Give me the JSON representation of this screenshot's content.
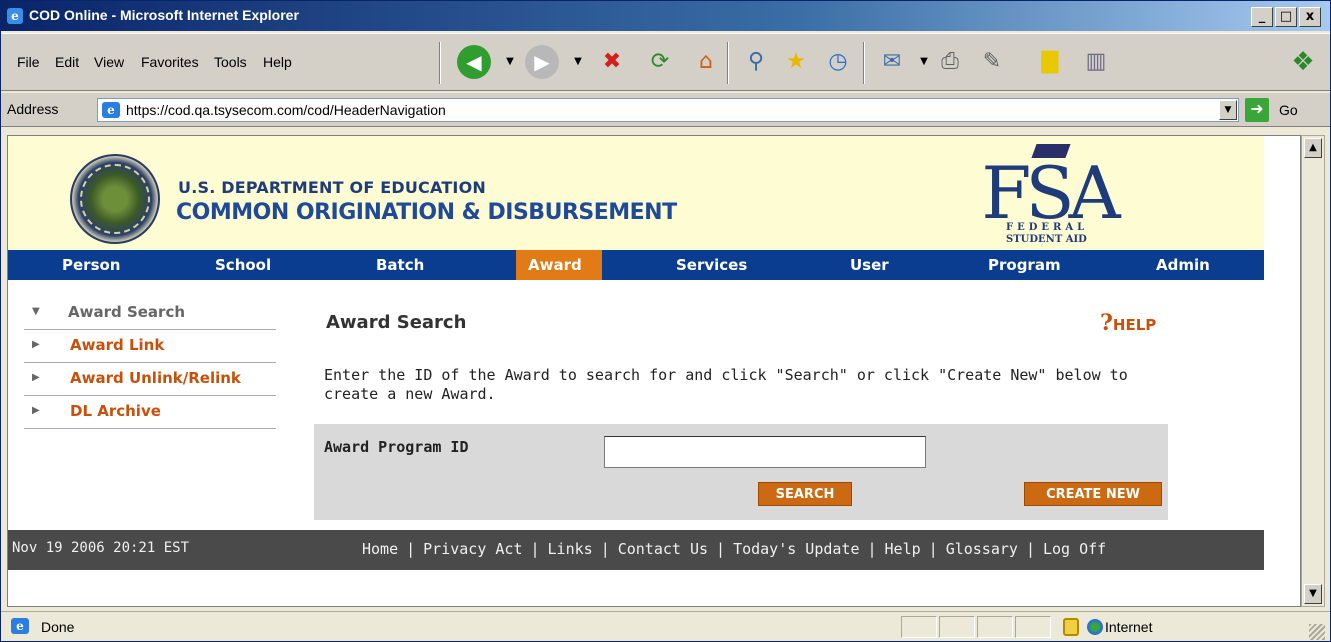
{
  "window": {
    "title": "COD Online - Microsoft Internet Explorer",
    "minimize": "_",
    "maximize": "□",
    "close": "x"
  },
  "menu": {
    "items": [
      "File",
      "Edit",
      "View",
      "Favorites",
      "Tools",
      "Help"
    ]
  },
  "toolbar": {
    "icons": [
      "back-icon",
      "forward-icon",
      "stop-icon",
      "refresh-icon",
      "home-icon",
      "search-icon",
      "favorites-icon",
      "history-icon",
      "mail-icon",
      "print-icon",
      "edit-icon",
      "discuss-icon",
      "research-icon"
    ]
  },
  "address": {
    "label": "Address",
    "url": "https://cod.qa.tsysecom.com/cod/HeaderNavigation",
    "go_label": "Go"
  },
  "banner": {
    "dept": "U.S. DEPARTMENT OF EDUCATION",
    "system": "COMMON ORIGINATION & DISBURSEMENT",
    "fsa_big": "FSA",
    "fsa_federal": "FEDERAL",
    "fsa_student_aid": "STUDENT AID"
  },
  "nav": {
    "items": [
      "Person",
      "School",
      "Batch",
      "Award",
      "Services",
      "User",
      "Program",
      "Admin"
    ],
    "active": "Award"
  },
  "sidebar": {
    "items": [
      {
        "label": "Award Search",
        "active": true
      },
      {
        "label": "Award Link",
        "active": false
      },
      {
        "label": "Award Unlink/Relink",
        "active": false
      },
      {
        "label": "DL Archive",
        "active": false
      }
    ]
  },
  "main": {
    "title": "Award Search",
    "help": "HELP",
    "instruction": "Enter the ID of the Award to search for and click \"Search\" or click \"Create New\" below to create a new Award.",
    "field_label": "Award Program ID",
    "field_value": "",
    "search_button": "SEARCH",
    "create_button": "CREATE NEW"
  },
  "footer": {
    "datetime": "Nov 19 2006 20:21 EST",
    "links": [
      "Home",
      "Privacy Act",
      "Links",
      "Contact Us",
      "Today's Update",
      "Help",
      "Glossary",
      "Log Off"
    ]
  },
  "status": {
    "text": "Done",
    "zone": "Internet"
  },
  "colors": {
    "nav_bg": "#0a3d8f",
    "nav_active": "#e07b16",
    "banner_bg": "#fdfcd2",
    "link_orange": "#c8500a",
    "footer_bg": "#4a4a4a"
  }
}
